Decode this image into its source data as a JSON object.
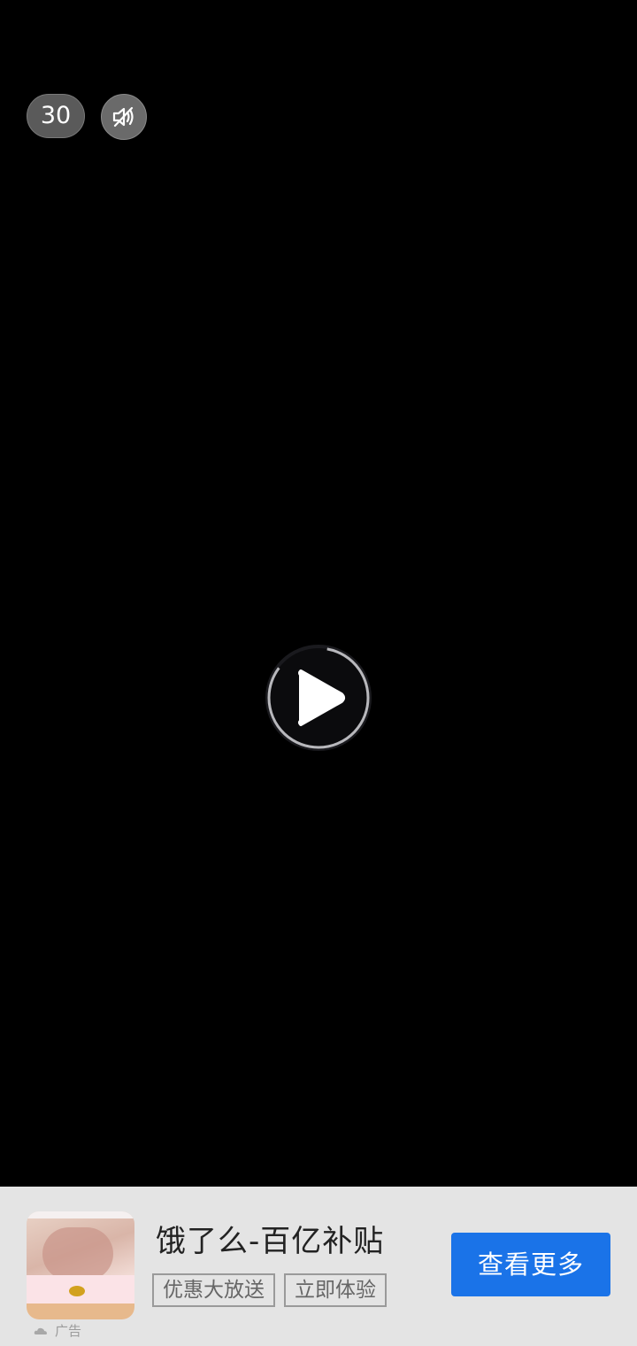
{
  "video": {
    "countdown": "30",
    "icons": {
      "mute": "speaker-muted-icon",
      "play": "play-icon"
    }
  },
  "ad": {
    "title": "饿了么-百亿补贴",
    "tags": [
      "优惠大放送",
      "立即体验"
    ],
    "cta_label": "查看更多",
    "ad_label": "广告",
    "colors": {
      "cta": "#1a73e8",
      "bar_bg": "#e4e4e4"
    }
  }
}
